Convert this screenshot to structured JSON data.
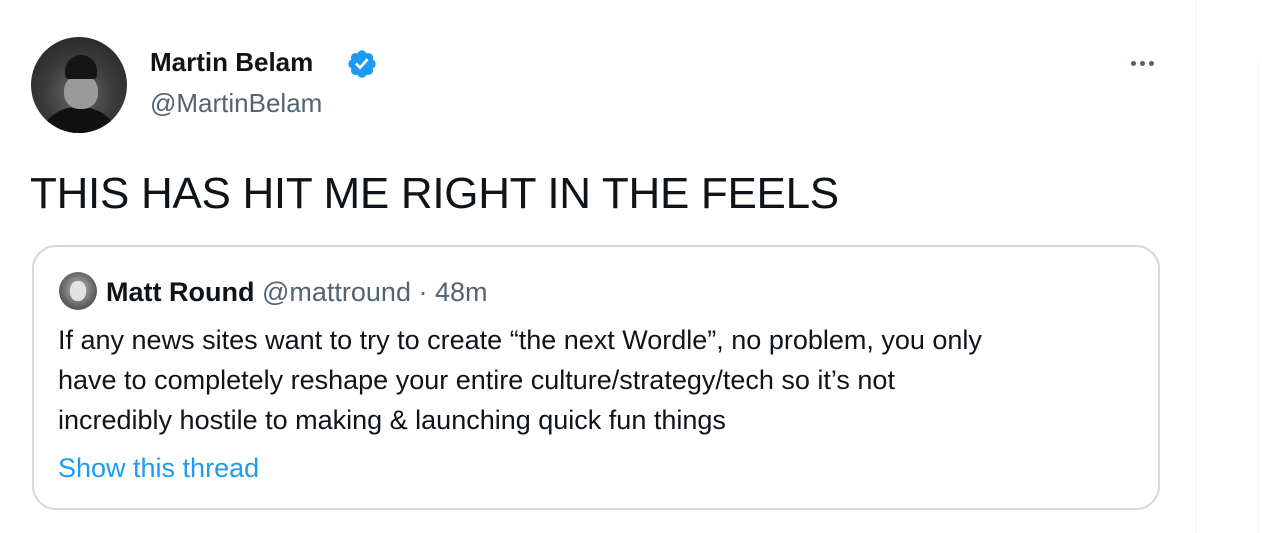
{
  "tweet": {
    "author_name": "Martin Belam",
    "author_handle": "@MartinBelam",
    "text": "THIS HAS HIT ME RIGHT IN THE FEELS"
  },
  "quote": {
    "author_name": "Matt Round",
    "author_handle": "@mattround",
    "separator": "·",
    "time": "48m",
    "lines": [
      "If any news sites want to try to create “the next Wordle”, no problem, you only",
      "have to completely reshape your entire culture/strategy/tech so it’s not",
      "incredibly hostile to making & launching quick fun things"
    ],
    "show_thread": "Show this thread"
  },
  "icons": {
    "verified": "verified-badge-icon",
    "more": "more-options-icon"
  },
  "colors": {
    "text": "#0f1419",
    "secondary": "#536471",
    "link": "#1d9bf0",
    "border": "#cfd9de"
  }
}
